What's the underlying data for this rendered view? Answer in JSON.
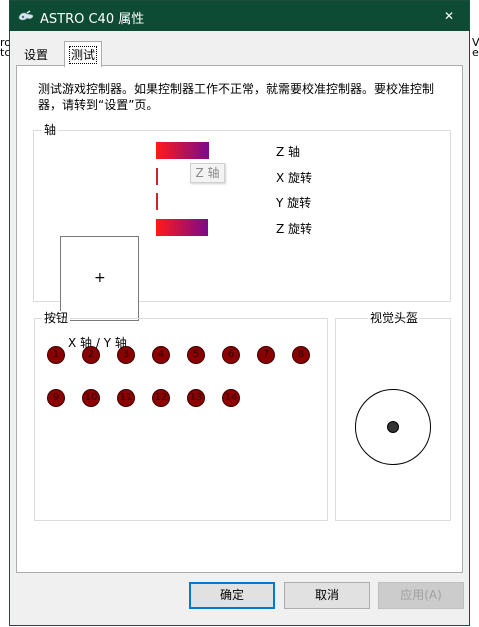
{
  "window": {
    "title": "ASTRO C40 属性",
    "close_glyph": "✕",
    "icon": "gamepad-icon"
  },
  "background_fragments": {
    "left_top": "ro",
    "left_bottom": "tc",
    "right_top": "V",
    "right_bottom": "e"
  },
  "tabs": [
    {
      "label": "设置"
    },
    {
      "label": "测试"
    }
  ],
  "description": "测试游戏控制器。如果控制器工作不正常，就需要校准控制器。要校准控制器，请转到“设置”页。",
  "axes": {
    "group_label": "轴",
    "xy_label": "X 轴 / Y 轴",
    "crosshair": "+",
    "items": [
      {
        "label": "Z 轴",
        "level": 0.38
      },
      {
        "label": "X 旋转",
        "level": 0.0
      },
      {
        "label": "Y 旋转",
        "level": 0.0
      },
      {
        "label": "Z 旋转",
        "level": 0.37
      }
    ],
    "tooltip": "Z 轴"
  },
  "buttons": {
    "group_label": "按钮",
    "items": [
      "1",
      "2",
      "3",
      "4",
      "5",
      "6",
      "7",
      "8",
      "9",
      "10",
      "11",
      "12",
      "13",
      "14"
    ]
  },
  "pov": {
    "group_label": "视觉头盔"
  },
  "dialog": {
    "ok_label": "确定",
    "cancel_label": "取消",
    "apply_label": "应用(A)"
  },
  "colors": {
    "title_bar": "#0d4b35",
    "axis_gradient_start": "#ff1a1a",
    "axis_gradient_end": "#7a0a8a",
    "button_fill": "#8b0000",
    "focus": "#0078d7"
  }
}
